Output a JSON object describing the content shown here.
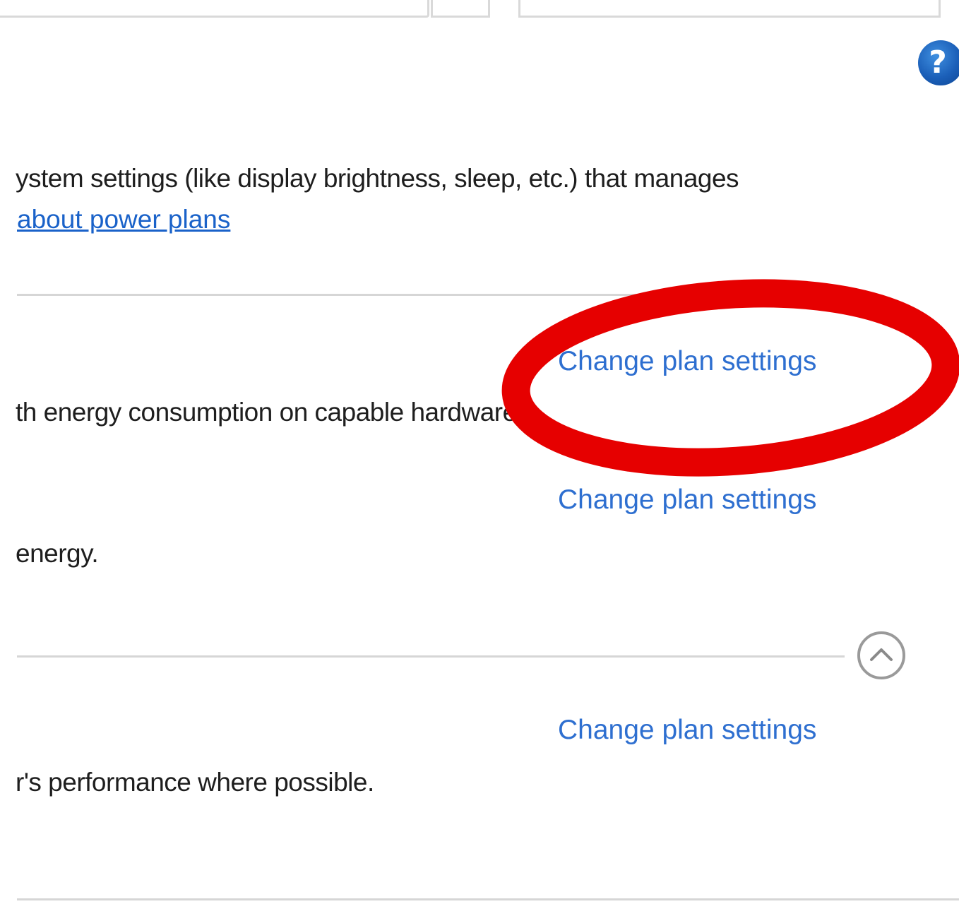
{
  "help": {
    "icon": "help-question-icon",
    "glyph": "?"
  },
  "power_plans": {
    "intro_text": "ystem settings (like display brightness, sleep, etc.) that manages",
    "learn_more_link": "about power plans",
    "plans": [
      {
        "description": "th energy consumption on capable hardware.",
        "link_label": "Change plan settings"
      },
      {
        "description": "energy.",
        "link_label": "Change plan settings"
      },
      {
        "description": "r's performance where possible.",
        "link_label": "Change plan settings"
      }
    ],
    "collapse_icon": "chevron-up-circle-icon"
  },
  "annotation": {
    "shape": "ellipse",
    "color": "#e60000"
  }
}
